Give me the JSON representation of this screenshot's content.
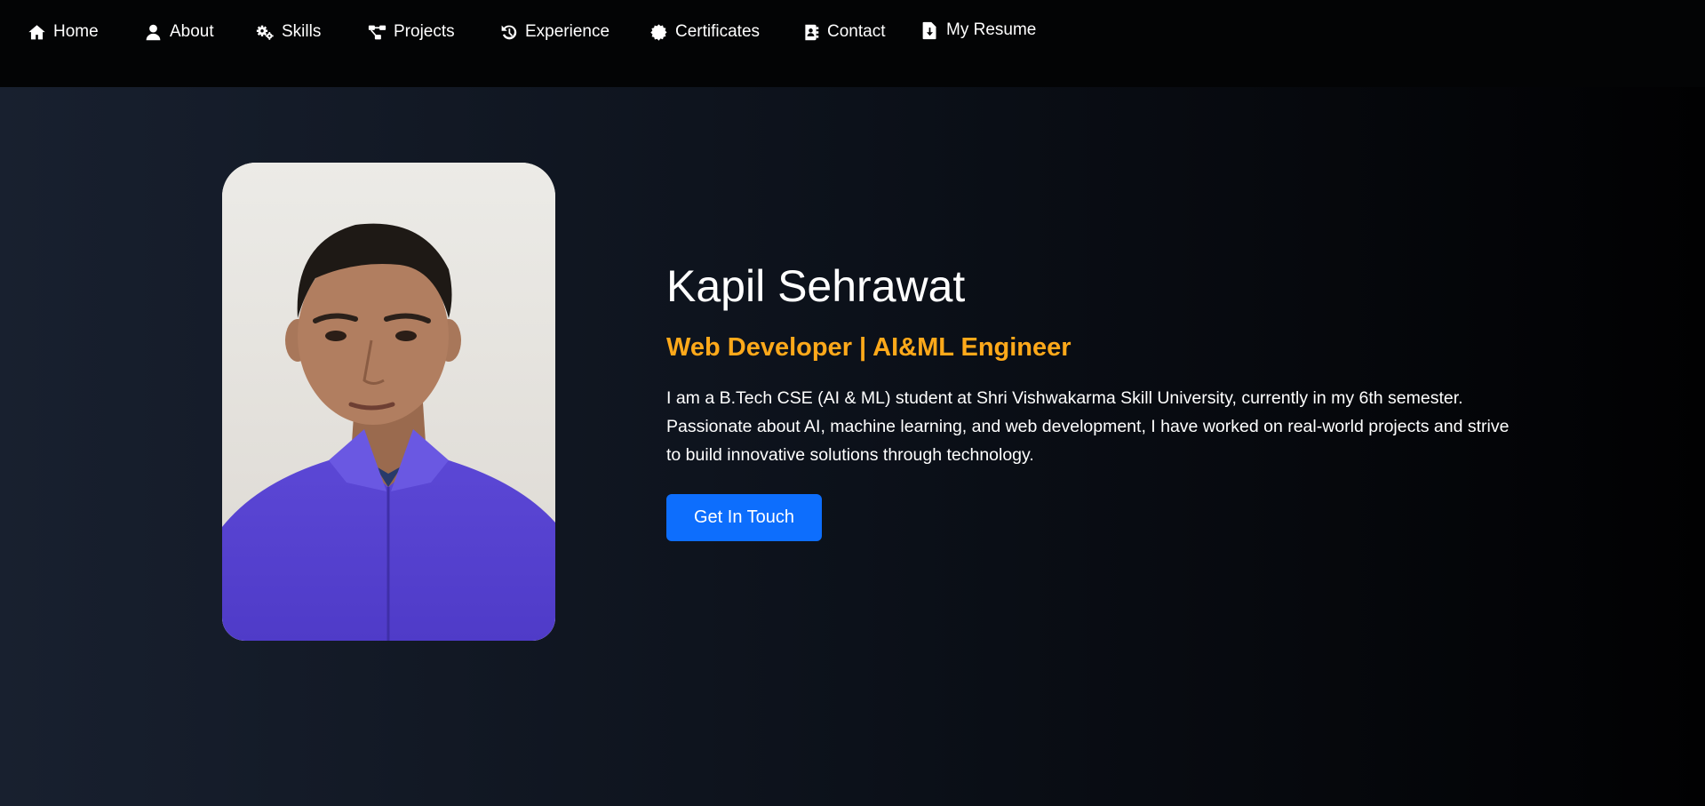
{
  "nav": {
    "items": [
      {
        "label": "Home",
        "icon": "home-icon"
      },
      {
        "label": "About",
        "icon": "user-icon"
      },
      {
        "label": "Skills",
        "icon": "gears-icon"
      },
      {
        "label": "Projects",
        "icon": "project-diagram-icon"
      },
      {
        "label": "Experience",
        "icon": "history-icon"
      },
      {
        "label": "Certificates",
        "icon": "certificate-icon"
      },
      {
        "label": "Contact",
        "icon": "address-book-icon"
      },
      {
        "label": "My Resume",
        "icon": "file-download-icon"
      }
    ]
  },
  "hero": {
    "name": "Kapil Sehrawat",
    "role": "Web Developer | AI&ML Engineer",
    "bio": "I am a B.Tech CSE (AI & ML) student at Shri Vishwakarma Skill University, currently in my 6th semester. Passionate about AI, machine learning, and web development, I have worked on real-world projects and strive to build innovative solutions through technology.",
    "cta_label": "Get In Touch"
  },
  "colors": {
    "accent": "#ffa91a",
    "button": "#0d6efd",
    "navbar_bg": "#030405",
    "hero_bg_start": "#18202f",
    "hero_bg_end": "#010102"
  }
}
